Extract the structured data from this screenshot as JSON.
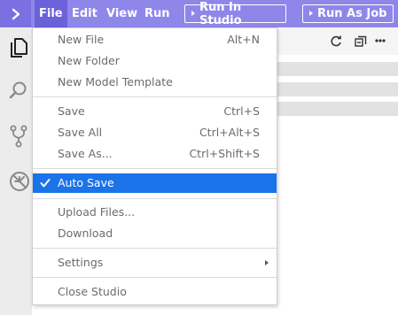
{
  "menubar": {
    "items": [
      {
        "label": "File"
      },
      {
        "label": "Edit"
      },
      {
        "label": "View"
      },
      {
        "label": "Run"
      }
    ],
    "run_in_studio": "Run In Studio",
    "run_as_job": "Run As Job"
  },
  "file_menu": {
    "new_file": {
      "label": "New File",
      "shortcut": "Alt+N"
    },
    "new_folder": {
      "label": "New Folder"
    },
    "new_model_template": {
      "label": "New Model Template"
    },
    "save": {
      "label": "Save",
      "shortcut": "Ctrl+S"
    },
    "save_all": {
      "label": "Save All",
      "shortcut": "Ctrl+Alt+S"
    },
    "save_as": {
      "label": "Save As...",
      "shortcut": "Ctrl+Shift+S"
    },
    "auto_save": {
      "label": "Auto Save",
      "checked": true
    },
    "upload_files": {
      "label": "Upload Files..."
    },
    "download": {
      "label": "Download"
    },
    "settings": {
      "label": "Settings"
    },
    "close_studio": {
      "label": "Close Studio"
    }
  },
  "icons": {
    "logo": "chevron-right-icon",
    "activity": [
      "files-icon",
      "search-icon",
      "source-control-icon",
      "extensions-icon"
    ],
    "toolbar": [
      "refresh-icon",
      "collapse-all-icon",
      "more-icon"
    ]
  },
  "colors": {
    "menubar": "#8f86ea",
    "menubar_active": "#6b61d9",
    "selection": "#1a73e8"
  }
}
